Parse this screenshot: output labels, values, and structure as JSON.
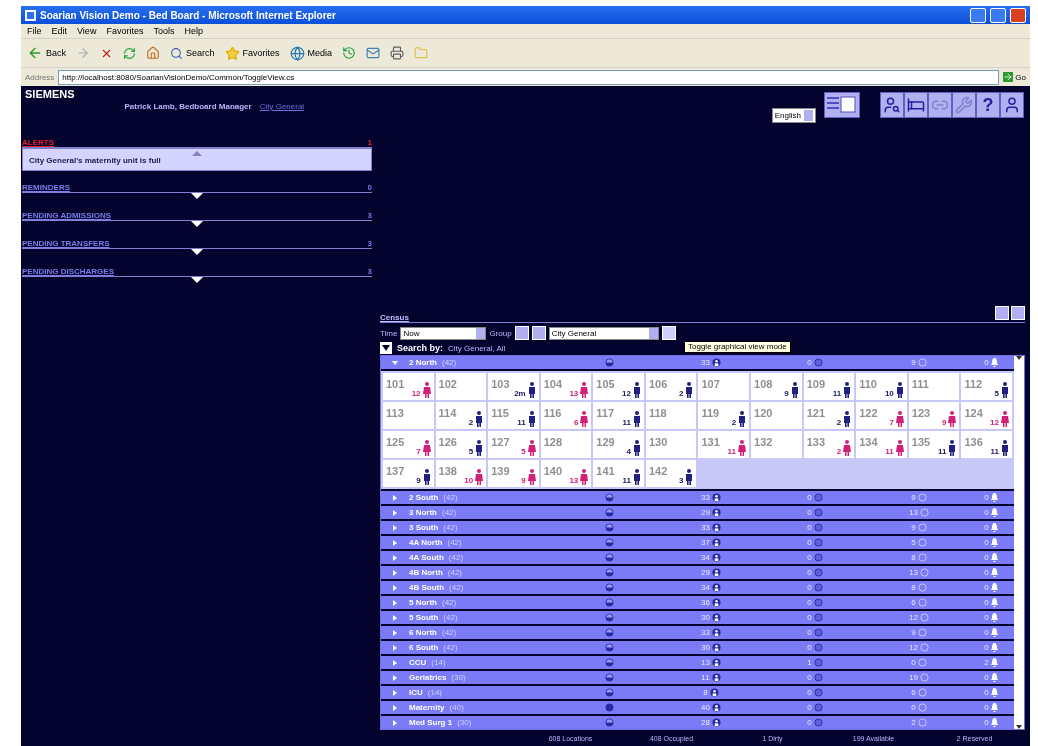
{
  "window": {
    "title": "Soarian Vision Demo - Bed Board - Microsoft Internet Explorer"
  },
  "menu": [
    "File",
    "Edit",
    "View",
    "Favorites",
    "Tools",
    "Help"
  ],
  "toolbar": [
    "Back",
    "Search",
    "Favorites",
    "Media"
  ],
  "address": {
    "label": "Address",
    "url": "http://localhost:8080/SoarianVisionDemo/Common/ToggleView.cs",
    "go": "Go"
  },
  "app": {
    "logo": "SIEMENS",
    "user": "Patrick Lamb, Bedboard Manager",
    "facility": "City General",
    "language": "English",
    "help": "?"
  },
  "panels": [
    {
      "title": "ALERTS",
      "count": "1",
      "urgent": true,
      "expanded": true,
      "items": [
        "City General's maternity unit is full"
      ]
    },
    {
      "title": "REMINDERS",
      "count": "0",
      "urgent": false,
      "expanded": false
    },
    {
      "title": "PENDING ADMISSIONS",
      "count": "3",
      "urgent": false,
      "expanded": false
    },
    {
      "title": "PENDING TRANSFERS",
      "count": "3",
      "urgent": false,
      "expanded": false
    },
    {
      "title": "PENDING DISCHARGES",
      "count": "3",
      "urgent": false,
      "expanded": false
    }
  ],
  "census": {
    "title": "Census",
    "time_label": "Time",
    "time": "Now",
    "group_label": "Group",
    "group": "City General",
    "tooltip": "Toggle graphical view mode",
    "search_label": "Search by:",
    "search_value": "City General, All",
    "wards": [
      {
        "name": "2 North",
        "capacity": "(42)",
        "expanded": true,
        "full": false,
        "occupied": "33",
        "dirty": "0",
        "available": "9",
        "reserved": "0",
        "beds": [
          {
            "number": "101",
            "stay": "12",
            "female": true
          },
          {
            "number": "102"
          },
          {
            "number": "103",
            "stay": "2m",
            "female": false
          },
          {
            "number": "104",
            "stay": "13",
            "female": true
          },
          {
            "number": "105",
            "stay": "12",
            "female": false
          },
          {
            "number": "106",
            "stay": "2",
            "female": false
          },
          {
            "number": "107"
          },
          {
            "number": "108",
            "stay": "9",
            "female": false
          },
          {
            "number": "109",
            "stay": "11",
            "female": false
          },
          {
            "number": "110",
            "stay": "10",
            "female": false
          },
          {
            "number": "111"
          },
          {
            "number": "112",
            "stay": "5",
            "female": false
          },
          {
            "number": "113"
          },
          {
            "number": "114",
            "stay": "2",
            "female": false
          },
          {
            "number": "115",
            "stay": "11",
            "female": false
          },
          {
            "number": "116",
            "stay": "6",
            "female": true
          },
          {
            "number": "117",
            "stay": "11",
            "female": false
          },
          {
            "number": "118"
          },
          {
            "number": "119",
            "stay": "2",
            "female": false
          },
          {
            "number": "120"
          },
          {
            "number": "121",
            "stay": "2",
            "female": false
          },
          {
            "number": "122",
            "stay": "7",
            "female": true
          },
          {
            "number": "123",
            "stay": "9",
            "female": true
          },
          {
            "number": "124",
            "stay": "12",
            "female": true
          },
          {
            "number": "125",
            "stay": "7",
            "female": true
          },
          {
            "number": "126",
            "stay": "5",
            "female": false
          },
          {
            "number": "127",
            "stay": "5",
            "female": true
          },
          {
            "number": "128"
          },
          {
            "number": "129",
            "stay": "4",
            "female": false
          },
          {
            "number": "130"
          },
          {
            "number": "131",
            "stay": "11",
            "female": true
          },
          {
            "number": "132"
          },
          {
            "number": "133",
            "stay": "2",
            "female": true
          },
          {
            "number": "134",
            "stay": "11",
            "female": true
          },
          {
            "number": "135",
            "stay": "11",
            "female": false
          },
          {
            "number": "136",
            "stay": "11",
            "female": false
          },
          {
            "number": "137",
            "stay": "9",
            "female": false
          },
          {
            "number": "138",
            "stay": "10",
            "female": true
          },
          {
            "number": "139",
            "stay": "9",
            "female": true
          },
          {
            "number": "140",
            "stay": "13",
            "female": true
          },
          {
            "number": "141",
            "stay": "11",
            "female": false
          },
          {
            "number": "142",
            "stay": "3",
            "female": false
          }
        ]
      },
      {
        "name": "2 South",
        "capacity": "(42)",
        "expanded": false,
        "full": false,
        "occupied": "33",
        "dirty": "0",
        "available": "9",
        "reserved": "0"
      },
      {
        "name": "3 North",
        "capacity": "(42)",
        "expanded": false,
        "full": false,
        "occupied": "29",
        "dirty": "0",
        "available": "13",
        "reserved": "0"
      },
      {
        "name": "3 South",
        "capacity": "(42)",
        "expanded": false,
        "full": false,
        "occupied": "33",
        "dirty": "0",
        "available": "9",
        "reserved": "0"
      },
      {
        "name": "4A North",
        "capacity": "(42)",
        "expanded": false,
        "full": false,
        "occupied": "37",
        "dirty": "0",
        "available": "5",
        "reserved": "0"
      },
      {
        "name": "4A South",
        "capacity": "(42)",
        "expanded": false,
        "full": false,
        "occupied": "34",
        "dirty": "0",
        "available": "8",
        "reserved": "0"
      },
      {
        "name": "4B North",
        "capacity": "(42)",
        "expanded": false,
        "full": false,
        "occupied": "29",
        "dirty": "0",
        "available": "13",
        "reserved": "0"
      },
      {
        "name": "4B South",
        "capacity": "(42)",
        "expanded": false,
        "full": false,
        "occupied": "34",
        "dirty": "0",
        "available": "8",
        "reserved": "0"
      },
      {
        "name": "5 North",
        "capacity": "(42)",
        "expanded": false,
        "full": false,
        "occupied": "36",
        "dirty": "0",
        "available": "6",
        "reserved": "0"
      },
      {
        "name": "5 South",
        "capacity": "(42)",
        "expanded": false,
        "full": false,
        "occupied": "30",
        "dirty": "0",
        "available": "12",
        "reserved": "0"
      },
      {
        "name": "6 North",
        "capacity": "(42)",
        "expanded": false,
        "full": false,
        "occupied": "33",
        "dirty": "0",
        "available": "9",
        "reserved": "0"
      },
      {
        "name": "6 South",
        "capacity": "(42)",
        "expanded": false,
        "full": false,
        "occupied": "30",
        "dirty": "0",
        "available": "12",
        "reserved": "0"
      },
      {
        "name": "CCU",
        "capacity": "(14)",
        "expanded": false,
        "full": false,
        "occupied": "13",
        "dirty": "1",
        "available": "0",
        "reserved": "2"
      },
      {
        "name": "Geriatrics",
        "capacity": "(30)",
        "expanded": false,
        "full": false,
        "occupied": "11",
        "dirty": "0",
        "available": "19",
        "reserved": "0"
      },
      {
        "name": "ICU",
        "capacity": "(14)",
        "expanded": false,
        "full": false,
        "occupied": "8",
        "dirty": "0",
        "available": "6",
        "reserved": "0"
      },
      {
        "name": "Maternity",
        "capacity": "(40)",
        "expanded": false,
        "full": true,
        "occupied": "40",
        "dirty": "0",
        "available": "0",
        "reserved": "0"
      },
      {
        "name": "Med Surg 1",
        "capacity": "(30)",
        "expanded": false,
        "full": false,
        "occupied": "28",
        "dirty": "0",
        "available": "2",
        "reserved": "0"
      }
    ],
    "totals": [
      "608 Locations",
      "408 Occupied",
      "1 Dirty",
      "199 Available",
      "2 Reserved"
    ]
  }
}
